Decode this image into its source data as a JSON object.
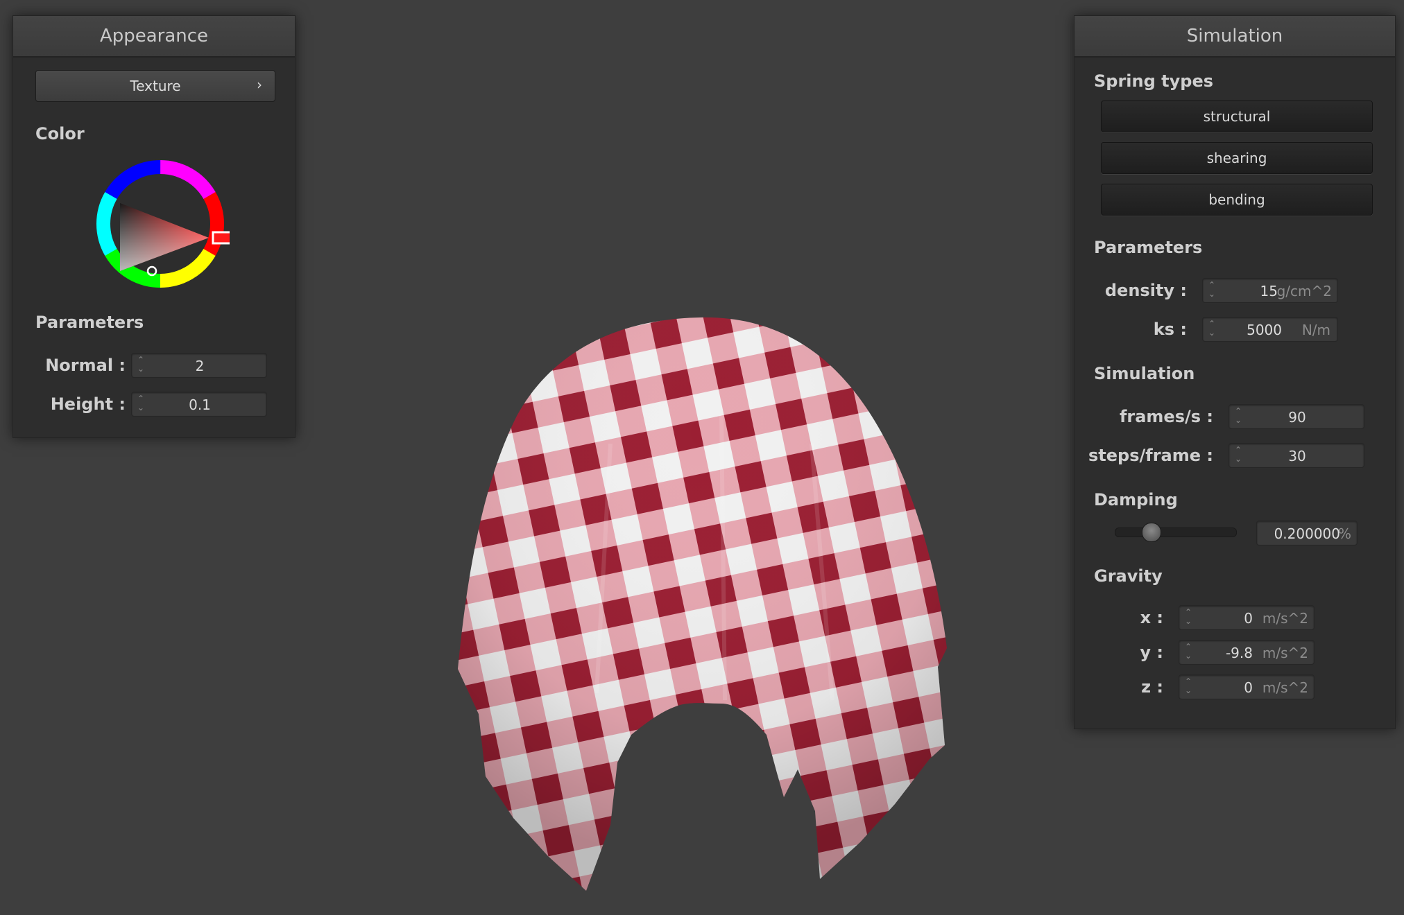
{
  "appearance": {
    "title": "Appearance",
    "texture_label": "Texture",
    "texture_chevron": "›",
    "color_section": "Color",
    "color_value": "#ff1a1a",
    "parameters_section": "Parameters",
    "normal_label": "Normal :",
    "normal_value": "2",
    "height_label": "Height :",
    "height_value": "0.1"
  },
  "simulation": {
    "title": "Simulation",
    "spring_types_section": "Spring types",
    "spring_types": [
      "structural",
      "shearing",
      "bending"
    ],
    "parameters_section": "Parameters",
    "density_label": "density :",
    "density_value": "15",
    "density_unit": "g/cm^2",
    "ks_label": "ks :",
    "ks_value": "5000",
    "ks_unit": "N/m",
    "simulation_section": "Simulation",
    "fps_label": "frames/s :",
    "fps_value": "90",
    "steps_label": "steps/frame :",
    "steps_value": "30",
    "damping_section": "Damping",
    "damping_value": "0.200000",
    "damping_unit": "%",
    "damping_fraction": 0.2,
    "gravity_section": "Gravity",
    "gx_label": "x :",
    "gx_value": "0",
    "gy_label": "y :",
    "gy_value": "-9.8",
    "gz_label": "z :",
    "gz_value": "0",
    "gravity_unit": "m/s^2"
  },
  "viewport": {
    "cloth_colors": {
      "dark": "#9b1f33",
      "light": "#e9a0ab",
      "white": "#f2f2f2"
    }
  }
}
